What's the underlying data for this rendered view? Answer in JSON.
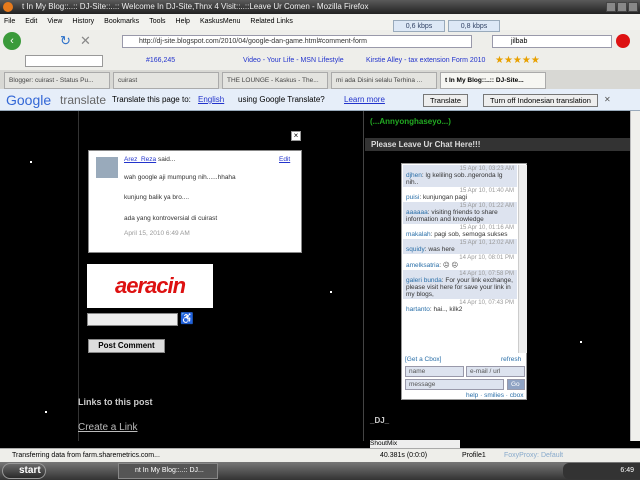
{
  "window": {
    "title": "t In My Blog::..:: DJ-Site::..:: Welcome In DJ-Site,Thnx 4 Visit::..::Leave Ur Comen - Mozilla Firefox"
  },
  "menu": [
    "File",
    "Edit",
    "View",
    "History",
    "Bookmarks",
    "Tools",
    "Help",
    "KaskusMenu",
    "Related Links"
  ],
  "speed": {
    "down": "0,6 kbps",
    "up": "0,8 kbps"
  },
  "nav": {
    "url": "http://dj-site.blogspot.com/2010/04/google-dan-game.html#comment-form",
    "search": "jilbab"
  },
  "bookmarks": {
    "rank": "#166,245",
    "item1": "Video - Your Life - MSN Lifestyle",
    "item2": "Kirstie Alley - tax extension Form 2010"
  },
  "tabs": [
    "Blogger: cuirast - Status Pu...",
    "cuirast",
    "THE LOUNGE - Kaskus - The...",
    "mi ada Disini selalu Terhina ...",
    "t In My Blog::..:: DJ-Site..."
  ],
  "translate": {
    "brand_google": "Google",
    "brand_translate": "translate",
    "prompt": "Translate this page to:",
    "language": "English",
    "using": "using Google Translate?",
    "learn_more": "Learn more",
    "translate_btn": "Translate",
    "turn_off_btn": "Turn off Indonesian translation"
  },
  "comment": {
    "author": "Arez_Reza",
    "said": "said...",
    "edit": "Edit",
    "lines": [
      "wah google aji mumpung nih......hhaha",
      "kunjung balik ya bro....",
      "ada yang kontroversial di cuirast"
    ],
    "date": "April 15, 2010 6:49 AM"
  },
  "captcha": {
    "word": "aeracin"
  },
  "post_comment": "Post Comment",
  "links_heading": "Links to this post",
  "create_link": "Create a Link",
  "sidebar": {
    "greeting": "(...Annyonghaseyo...)",
    "chat_heading": "Please Leave Ur Chat Here!!!",
    "footer_heading": "_DJ_",
    "shoutmix": "ShoutMix"
  },
  "cbox": {
    "messages": [
      {
        "time": "15 Apr 10, 03:23 AM",
        "name": "djhen",
        "text": ": lg keliling sob..ngeronda lg nih.."
      },
      {
        "time": "15 Apr 10, 01:40 AM",
        "name": "puisi",
        "text": ": kunjungan pagi"
      },
      {
        "time": "15 Apr 10, 01:22 AM",
        "name": "aaaaaa",
        "text": ": visiting friends to share information and knowledge"
      },
      {
        "time": "15 Apr 10, 01:16 AM",
        "name": "makalah",
        "text": ": pagi sob, semoga sukses"
      },
      {
        "time": "15 Apr 10, 12:02 AM",
        "name": "squidy",
        "text": ": was here"
      },
      {
        "time": "14 Apr 10, 08:01 PM",
        "name": "amelksatria",
        "text": ": ☹ ☹"
      },
      {
        "time": "14 Apr 10, 07:58 PM",
        "name": "galeri bunda",
        "text": ": For your link exchange, please visit here for save your link in my blogs,"
      },
      {
        "time": "14 Apr 10, 07:43 PM",
        "name": "hartanto",
        "text": ": hai.., kilk2"
      }
    ],
    "get": "[Get a Cbox]",
    "refresh": "refresh",
    "name_ph": "name",
    "email_ph": "e-mail / url",
    "message_ph": "message",
    "go": "Go",
    "help": "help",
    "smilies": "smilies",
    "cbox": "cbox"
  },
  "status": {
    "text": "Transferring data from farm.sharemetrics.com...",
    "timer": "40.381s (0:0:0)",
    "profile": "Profile1",
    "proxy": "FoxyProxy: Default"
  },
  "taskbar": {
    "start": "start",
    "task": "nt In My Blog::..:: DJ...",
    "clock": "6:49"
  }
}
